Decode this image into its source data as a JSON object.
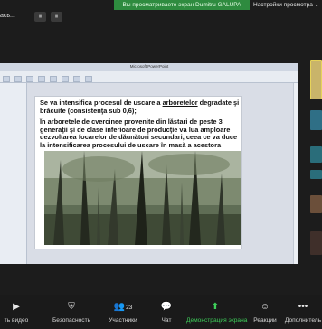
{
  "topbar": {
    "left_text": "ась...",
    "share_banner": "Вы просматриваете экран Dumitru GALUPA",
    "view_settings": "Настройки просмотра"
  },
  "top_buttons": [
    "⏸",
    "⏸"
  ],
  "slide": {
    "paragraph1_prefix": "Se va intensifica procesul de uscare a ",
    "paragraph1_underlined": "arboretelor",
    "paragraph1_suffix": " degradate şi brăcuite (consistenţa sub 0,6);",
    "paragraph2": "În arboretele de cvercinee provenite din lăstari de peste 3 generaţii şi de clase inferioare de producţie  va lua amploare dezvoltarea focarelor de dăunători secundari, ceea ce va duce la intensificarea procesului de uscare în masă a acestora"
  },
  "ppt_title": "Microsoft PowerPoint",
  "toolbar": {
    "items": [
      {
        "id": "video",
        "label": "ть видео",
        "icon": "video-icon",
        "glyph": "▶"
      },
      {
        "id": "security",
        "label": "Безопасность",
        "icon": "shield-icon",
        "glyph": "⛨"
      },
      {
        "id": "participants",
        "label": "Участники",
        "icon": "participants-icon",
        "glyph": "👥",
        "count": "23"
      },
      {
        "id": "chat",
        "label": "Чат",
        "icon": "chat-icon",
        "glyph": "💬"
      },
      {
        "id": "share",
        "label": "Демонстрация экрана",
        "icon": "share-screen-icon",
        "glyph": "⬆"
      },
      {
        "id": "reactions",
        "label": "Реакции",
        "icon": "reactions-icon",
        "glyph": "☺"
      },
      {
        "id": "more",
        "label": "Дополнитель",
        "icon": "more-icon",
        "glyph": "•••"
      }
    ]
  },
  "colors": {
    "banner_green": "#2e8b3f",
    "share_green": "#3ecf5a",
    "background": "#1c1c1c"
  }
}
